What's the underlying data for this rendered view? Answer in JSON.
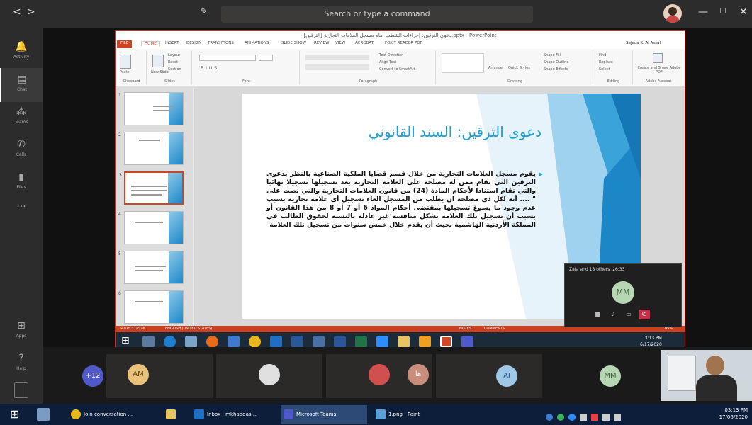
{
  "teams": {
    "search_placeholder": "Search or type a command",
    "nav_back": "<",
    "nav_forward": ">",
    "rail": [
      {
        "label": "Activity",
        "icon": "bell-icon"
      },
      {
        "label": "Chat",
        "icon": "chat-icon"
      },
      {
        "label": "Teams",
        "icon": "teams-icon"
      },
      {
        "label": "Calls",
        "icon": "phone-icon"
      },
      {
        "label": "Files",
        "icon": "file-icon"
      },
      {
        "label": "...",
        "icon": "more-icon"
      },
      {
        "label": "Apps",
        "icon": "apps-icon"
      },
      {
        "label": "Help",
        "icon": "help-icon"
      }
    ]
  },
  "ppt": {
    "title": "دعوى الترقين:  إجراءات الشطب أمام مسجل العلامات التجارية [الترقين].pptx - PowerPoint",
    "tabs": [
      "FILE",
      "HOME",
      "INSERT",
      "DESIGN",
      "TRANSITIONS",
      "ANIMATIONS",
      "SLIDE SHOW",
      "REVIEW",
      "VIEW",
      "ACROBAT",
      "FOXIT READER PDF"
    ],
    "user": "Sajeda K. Al Assaf",
    "ribbon_groups": [
      "Clipboard",
      "Slides",
      "Font",
      "Paragraph",
      "Drawing",
      "Editing",
      "Adobe Acrobat"
    ],
    "ribbon_buttons": {
      "paste": "Paste",
      "new_slide": "New Slide",
      "layout": "Layout",
      "reset": "Reset",
      "section": "Section",
      "text_direction": "Text Direction",
      "align_text": "Align Text",
      "smartart": "Convert to SmartArt",
      "arrange": "Arrange",
      "quick_styles": "Quick Styles",
      "shape_fill": "Shape Fill",
      "shape_outline": "Shape Outline",
      "shape_effects": "Shape Effects",
      "find": "Find",
      "replace": "Replace",
      "select": "Select",
      "create_pdf": "Create and Share Adobe PDF"
    },
    "slide": {
      "title": "دعوى الترقين: السند القانوني",
      "body": "يقوم مسجل العلامات التجارية من خلال قسم قضايا الملكية الصناعية بالنظر بدعوى الترقين التي تقام ممن له مصلحة على العلامة التجارية بعد تسجيلها تسجيلا نهائيا والتي تقام استنادا لأحكام المادة (24) من قانون العلامات التجارية والتي نصت على \" .... أنه لكل ذي مصلحة ان يطلب من المسجل الغاء تسجيل أي علامة تجارية بسبب عدم وجود ما يسوغ تسجيلها بمقتضى أحكام المواد 6 أو 7 أو 8 من هذا القانون أو بسبب أن تسجيل تلك العلامة تشكل منافسة غير عادلة بالنسبة لحقوق الطالب في المملكة الأردنية الهاشمية بحيث أن يقدم خلال خمس سنوات من تسجيل تلك العلامة"
    },
    "thumb_numbers": [
      "1",
      "2",
      "3",
      "4",
      "5",
      "6"
    ],
    "status_left": "SLIDE 3 OF 16",
    "status_lang": "ENGLISH (UNITED STATES)",
    "status_notes": "NOTES",
    "status_comments": "COMMENTS",
    "status_zoom": "85%",
    "guest_clock_time": "3:13 PM",
    "guest_clock_date": "6/17/2020"
  },
  "call": {
    "name": "Zafa and 18 others",
    "duration": "26:33",
    "initials": "MM"
  },
  "participants": {
    "overflow": "+12",
    "tiles": [
      {
        "initials": "AM",
        "color": "#e8c17a",
        "fg": "#5a3e10"
      },
      {
        "initials": "",
        "color": "#e0e0e0",
        "fg": "#333"
      },
      {
        "initials": "",
        "color": "#d05050",
        "fg": "#fff"
      },
      {
        "initials": "ها",
        "color": "#c98d7c",
        "fg": "#fff"
      },
      {
        "initials": "AI",
        "color": "#9ec7e8",
        "fg": "#1d4e7a"
      },
      {
        "initials": "MM",
        "color": "#b7d7b4",
        "fg": "#3b5f39"
      }
    ]
  },
  "taskbar": {
    "items": [
      {
        "label": "Join conversation ...",
        "icon": "chrome-icon",
        "color": "#e8b81a"
      },
      {
        "label": "",
        "icon": "explorer-icon",
        "color": "#e8c462"
      },
      {
        "label": "Inbox - mkhaddas...",
        "icon": "outlook-icon",
        "color": "#1f6fc5"
      },
      {
        "label": "Microsoft Teams",
        "icon": "teams-icon",
        "color": "#5059c9"
      },
      {
        "label": "1.png - Paint",
        "icon": "paint-icon",
        "color": "#5aa0d6"
      }
    ],
    "time": "03:13 PM",
    "date": "17/06/2020"
  }
}
